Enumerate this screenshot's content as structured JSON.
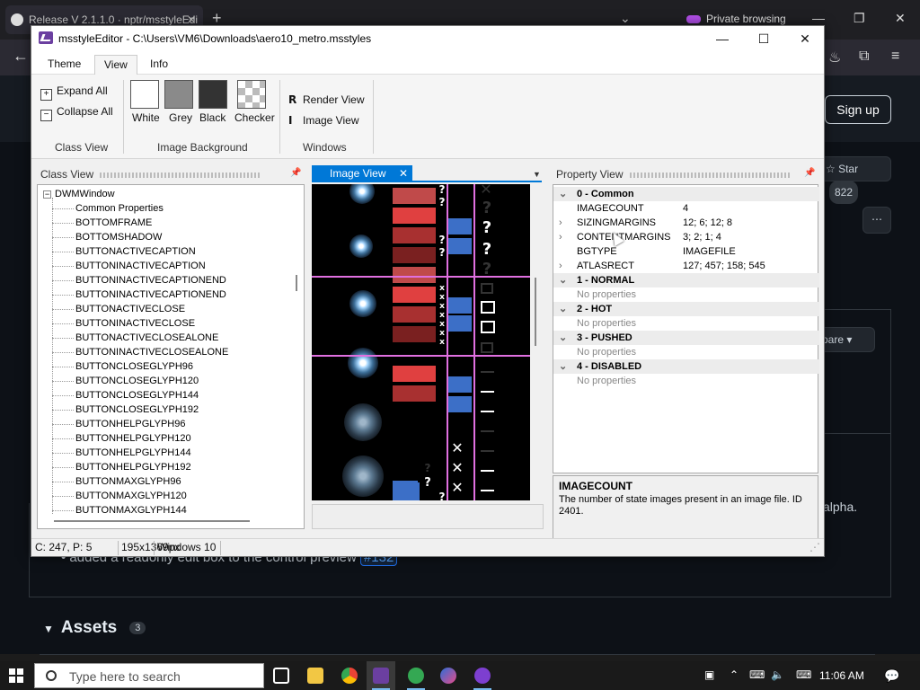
{
  "browser": {
    "tab_title": "Release V 2.1.1.0 · nptr/msstyleEdi",
    "private_label": "Private browsing",
    "signup": "Sign up",
    "star": "Star",
    "star_count": "822",
    "compare": "pare",
    "frag1": ".",
    "frag2": "alpha.",
    "bullet_text": "added a readonly edit box to the control preview",
    "bullet_link": "#132",
    "assets_label": "Assets",
    "assets_count": "3"
  },
  "window": {
    "title": "msstyleEditor - C:\\Users\\VM6\\Downloads\\aero10_metro.msstyles"
  },
  "menu": {
    "tabs": [
      "Theme",
      "View",
      "Info"
    ],
    "active": "View"
  },
  "ribbon": {
    "expand_all": "Expand All",
    "collapse_all": "Collapse All",
    "class_view_group": "Class View",
    "bg_white": "White",
    "bg_grey": "Grey",
    "bg_black": "Black",
    "bg_checker": "Checker",
    "image_bg_group": "Image Background",
    "render_view": "Render View",
    "image_view": "Image View",
    "render_view_key": "R",
    "image_view_key": "I",
    "windows_group": "Windows"
  },
  "class_view": {
    "title": "Class View",
    "root": "DWMWindow",
    "items": [
      "Common Properties",
      "BOTTOMFRAME",
      "BOTTOMSHADOW",
      "BUTTONACTIVECAPTION",
      "BUTTONINACTIVECAPTION",
      "BUTTONINACTIVECAPTIONEND",
      "BUTTONINACTIVECAPTIONEND",
      "BUTTONACTIVECLOSE",
      "BUTTONINACTIVECLOSE",
      "BUTTONACTIVECLOSEALONE",
      "BUTTONINACTIVECLOSEALONE",
      "BUTTONCLOSEGLYPH96",
      "BUTTONCLOSEGLYPH120",
      "BUTTONCLOSEGLYPH144",
      "BUTTONCLOSEGLYPH192",
      "BUTTONHELPGLYPH96",
      "BUTTONHELPGLYPH120",
      "BUTTONHELPGLYPH144",
      "BUTTONHELPGLYPH192",
      "BUTTONMAXGLYPH96",
      "BUTTONMAXGLYPH120",
      "BUTTONMAXGLYPH144"
    ]
  },
  "image_view": {
    "tab_label": "Image View"
  },
  "property_view": {
    "title": "Property View",
    "common": {
      "label": "0 - Common",
      "rows": [
        {
          "key": "IMAGECOUNT",
          "value": "4",
          "expandable": false
        },
        {
          "key": "SIZINGMARGINS",
          "value": "12; 6; 12; 8",
          "expandable": true
        },
        {
          "key": "CONTENTMARGINS",
          "value": "3; 2; 1; 4",
          "expandable": true
        },
        {
          "key": "BGTYPE",
          "value": "IMAGEFILE",
          "expandable": false
        },
        {
          "key": "ATLASRECT",
          "value": "127; 457; 158; 545",
          "expandable": true
        }
      ]
    },
    "states": [
      {
        "label": "1 - NORMAL",
        "note": "No properties"
      },
      {
        "label": "2 - HOT",
        "note": "No properties"
      },
      {
        "label": "3 - PUSHED",
        "note": "No properties"
      },
      {
        "label": "4 - DISABLED",
        "note": "No properties"
      }
    ],
    "desc_title": "IMAGECOUNT",
    "desc_text": "The number of state images present in an image file. ID 2401."
  },
  "status": {
    "cursor": "C: 247, P: 5",
    "size": "195x1369px",
    "platform": "Windows 10"
  },
  "taskbar": {
    "search_placeholder": "Type here to search",
    "time": "11:06 AM"
  },
  "colors": {
    "accent": "#0078d7",
    "pink_guides": "#e070e0",
    "red_states": [
      "#c04a4a",
      "#e04040",
      "#a83030",
      "#7a2020"
    ],
    "blue_states": "#3c6fc7"
  }
}
